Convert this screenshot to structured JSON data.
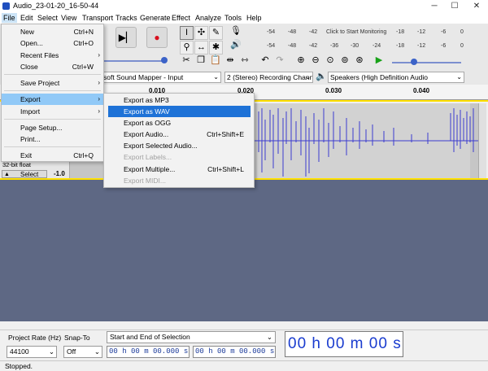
{
  "window": {
    "title": "Audio_23-01-20_16-50-44",
    "minimize": "─",
    "maximize": "☐",
    "close": "✕"
  },
  "menubar": {
    "items": [
      "File",
      "Edit",
      "Select",
      "View",
      "Transport",
      "Tracks",
      "Generate",
      "Effect",
      "Analyze",
      "Tools",
      "Help"
    ]
  },
  "toolbar": {
    "meter_start_label": "Click to Start Monitoring",
    "meter_record_scale": [
      "-54",
      "-48",
      "-42",
      "-18",
      "-12",
      "-6",
      "0"
    ],
    "meter_play_scale": [
      "-54",
      "-48",
      "-42",
      "-36",
      "-30",
      "-24",
      "-18",
      "-12",
      "-6",
      "0"
    ],
    "playback_host_suffix": "soft Sound Mapper - Input",
    "recording_channels": "2 (Stereo) Recording Chann",
    "playback_device": "Speakers (High Definition Audio"
  },
  "ruler": {
    "ticks": [
      "0.010",
      "0.020",
      "0.030",
      "0.040"
    ]
  },
  "track": {
    "format": "32-bit float",
    "select_label": "Select",
    "scale_value": "-1.0"
  },
  "file_menu": {
    "items": [
      {
        "label": "New",
        "shortcut": "Ctrl+N"
      },
      {
        "label": "Open...",
        "shortcut": "Ctrl+O"
      },
      {
        "label": "Recent Files",
        "shortcut": ""
      },
      {
        "label": "Close",
        "shortcut": "Ctrl+W"
      },
      {
        "label": "Save Project",
        "shortcut": ""
      },
      {
        "label": "Export",
        "shortcut": ""
      },
      {
        "label": "Import",
        "shortcut": ""
      },
      {
        "label": "Page Setup...",
        "shortcut": ""
      },
      {
        "label": "Print...",
        "shortcut": ""
      },
      {
        "label": "Exit",
        "shortcut": "Ctrl+Q"
      }
    ]
  },
  "export_menu": {
    "items": [
      {
        "label": "Export as MP3",
        "shortcut": ""
      },
      {
        "label": "Export as WAV",
        "shortcut": ""
      },
      {
        "label": "Export as OGG",
        "shortcut": ""
      },
      {
        "label": "Export Audio...",
        "shortcut": "Ctrl+Shift+E"
      },
      {
        "label": "Export Selected Audio...",
        "shortcut": ""
      },
      {
        "label": "Export Labels...",
        "shortcut": ""
      },
      {
        "label": "Export Multiple...",
        "shortcut": "Ctrl+Shift+L"
      },
      {
        "label": "Export MIDI...",
        "shortcut": ""
      }
    ]
  },
  "bottom": {
    "project_rate_label": "Project Rate (Hz)",
    "project_rate_value": "44100",
    "snap_to_label": "Snap-To",
    "snap_to_value": "Off",
    "selection_mode": "Start and End of Selection",
    "selection_start": "00 h 00 m 00.000 s",
    "selection_end": "00 h 00 m 00.000 s",
    "big_time": "00 h 00 m 00 s"
  },
  "status": {
    "text": "Stopped."
  },
  "colors": {
    "accent": "#1e72d7",
    "track_border": "#ffe100",
    "waveform": "#3c3cd0",
    "background_track_area": "#5e6884"
  }
}
